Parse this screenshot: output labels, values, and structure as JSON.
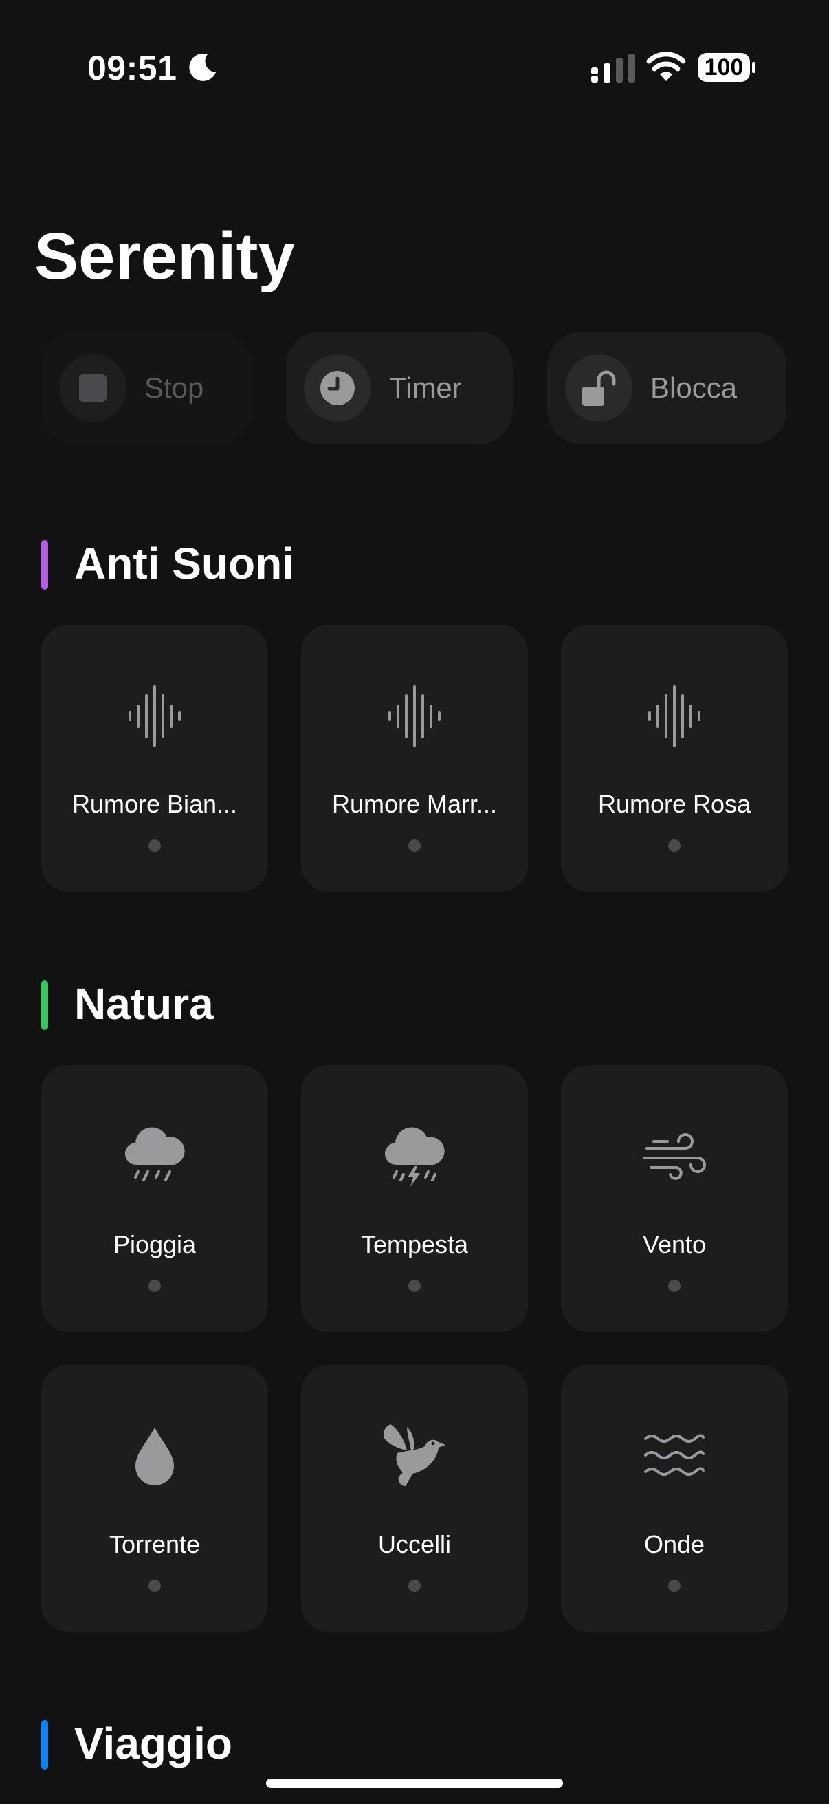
{
  "status": {
    "time": "09:51",
    "battery": "100"
  },
  "app": {
    "title": "Serenity"
  },
  "controls": [
    {
      "label": "Stop",
      "icon": "stop-icon"
    },
    {
      "label": "Timer",
      "icon": "clock-icon"
    },
    {
      "label": "Blocca",
      "icon": "unlock-icon"
    }
  ],
  "sections": [
    {
      "title": "Anti Suoni",
      "color": "#b55ce6",
      "items": [
        {
          "label": "Rumore Bian...",
          "icon": "waveform-icon"
        },
        {
          "label": "Rumore Marr...",
          "icon": "waveform-icon"
        },
        {
          "label": "Rumore Rosa",
          "icon": "waveform-icon"
        }
      ]
    },
    {
      "title": "Natura",
      "color": "#34c759",
      "items": [
        {
          "label": "Pioggia",
          "icon": "cloud-rain-icon"
        },
        {
          "label": "Tempesta",
          "icon": "cloud-bolt-rain-icon"
        },
        {
          "label": "Vento",
          "icon": "wind-icon"
        },
        {
          "label": "Torrente",
          "icon": "drop-icon"
        },
        {
          "label": "Uccelli",
          "icon": "bird-icon"
        },
        {
          "label": "Onde",
          "icon": "water-waves-icon"
        }
      ]
    },
    {
      "title": "Viaggio",
      "color": "#0a84ff"
    }
  ]
}
